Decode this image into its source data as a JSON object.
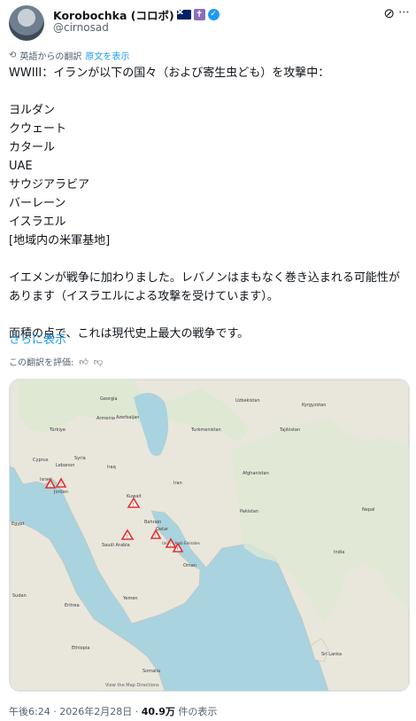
{
  "author": {
    "display_name": "Korobochka (コロボ)",
    "handle": "@cirnosad"
  },
  "translation": {
    "label": "英語からの翻訳",
    "show_original": "原文を表示"
  },
  "post": {
    "line_1": "WWIII：イランが以下の国々（および寄生虫ども）を攻撃中：",
    "countries": [
      "ヨルダン",
      "クウェート",
      "カタール",
      "UAE",
      "サウジアラビア",
      "バーレーン",
      "イスラエル",
      "[地域内の米軍基地]"
    ],
    "paragraph_2": "イエメンが戦争に加わりました。レバノンはまもなく巻き込まれる可能性があります（イスラエルによる攻撃を受けています）。",
    "paragraph_3": "面積の点で、これは現代史上最大の戦争です。",
    "show_more": "さらに表示"
  },
  "rate_translation": "この翻訳を評価:",
  "map": {
    "labels": {
      "georgia": "Georgia",
      "uzbekistan": "Uzbekistan",
      "kyrgyzstan": "Kyrgyzstan",
      "armenia": "Armenia",
      "azerbaijan": "Azerbaijan",
      "turkiye": "Türkiye",
      "turkmenistan": "Turkmenistan",
      "tajikistan": "Tajikistan",
      "cyprus": "Cyprus",
      "lebanon": "Lebanon",
      "syria": "Syria",
      "iraq": "Iraq",
      "iran": "Iran",
      "afghanistan": "Afghanistan",
      "israel": "Israel",
      "jordan": "Jordan",
      "egypt": "Egypt",
      "kuwait": "Kuwait",
      "pakistan": "Pakistan",
      "nepal": "Nepal",
      "bahrain": "Bahrain",
      "qatar": "Qatar",
      "saudi_arabia": "Saudi Arabia",
      "uae": "United Arab Emirates",
      "oman": "Oman",
      "india": "India",
      "sudan": "Sudan",
      "eritrea": "Eritrea",
      "yemen": "Yemen",
      "ethiopia": "Ethiopia",
      "sri_lanka": "Sri Lanka",
      "somalia": "Somalia"
    },
    "attribution": "View the Map Directions"
  },
  "meta": {
    "time": "午後6:24",
    "date": "2026年2月28日",
    "views": "40.9万",
    "views_suffix": "件の表示"
  },
  "colors": {
    "accent": "#1d9bf0",
    "water": "#a9d3df",
    "land": "#e9e6dc",
    "marker": "#e0302d"
  }
}
